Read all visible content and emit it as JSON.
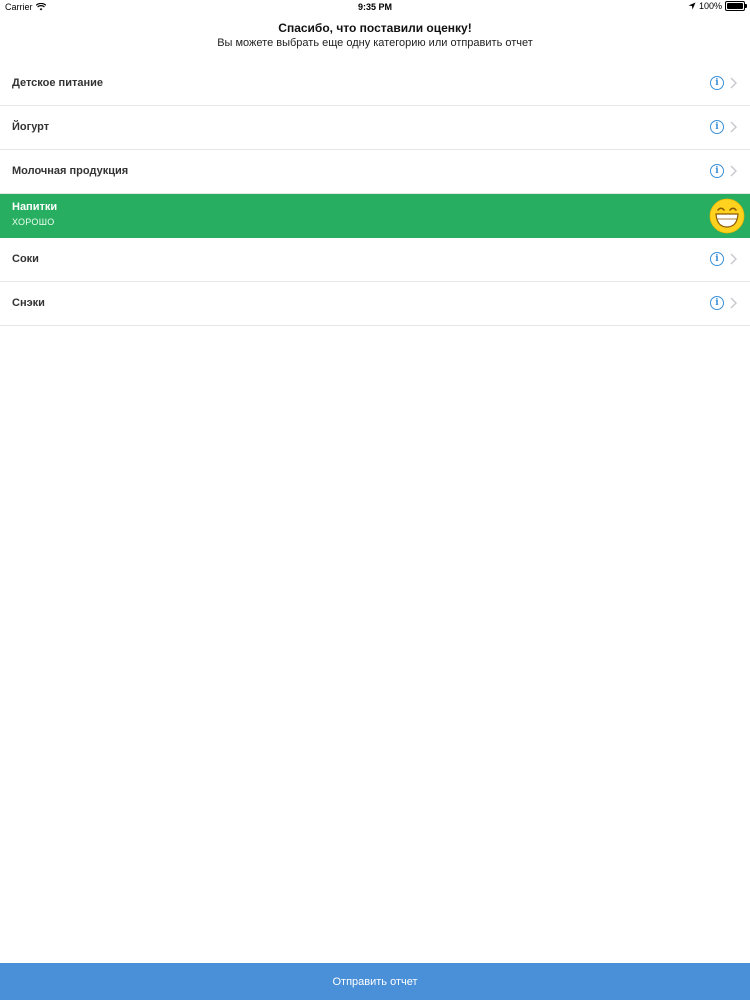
{
  "status_bar": {
    "carrier": "Carrier",
    "time": "9:35 PM",
    "battery": "100%",
    "battery_level": 1.0
  },
  "header": {
    "title": "Спасибо, что поставили оценку!",
    "subtitle": "Вы можете выбрать еще одну категорию или отправить отчет"
  },
  "categories": [
    {
      "label": "Детское питание",
      "icon": "info-icon"
    },
    {
      "label": "Йогурт",
      "icon": "info-icon"
    },
    {
      "label": "Молочная продукция",
      "icon": "info-icon"
    },
    {
      "label": "Напитки",
      "rating": "ХОРОШО",
      "icon": "grinning-face-icon",
      "highlight_color": "#27AE60"
    },
    {
      "label": "Соки",
      "icon": "info-icon"
    },
    {
      "label": "Снэки",
      "icon": "info-icon"
    }
  ],
  "footer": {
    "send_label": "Отправить отчет",
    "color": "#4A90D9"
  }
}
